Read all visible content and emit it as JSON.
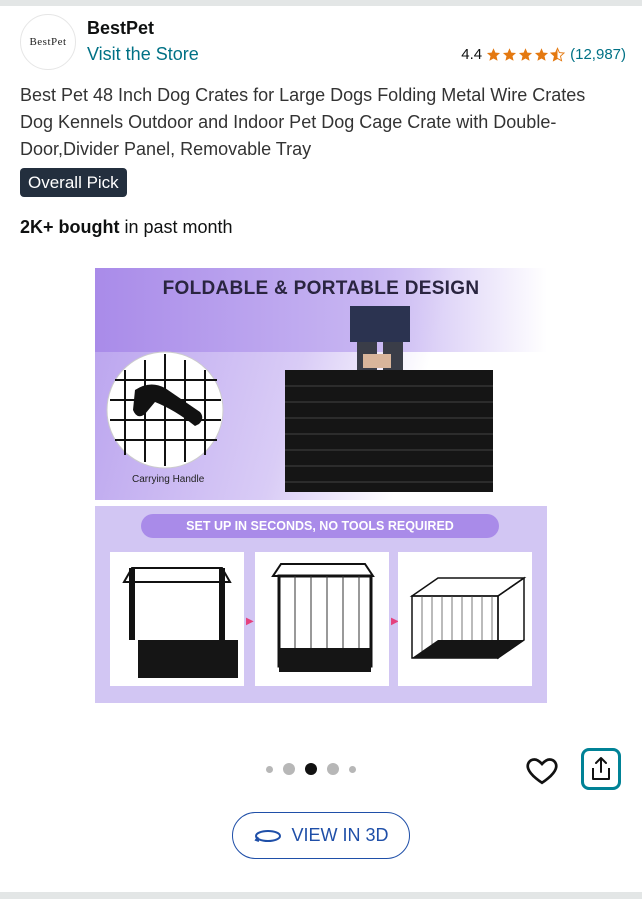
{
  "store": {
    "logo_text": "BestPet",
    "name": "BestPet",
    "visit_label": "Visit the Store"
  },
  "rating": {
    "value": "4.4",
    "stars": 4.5,
    "count": "(12,987)",
    "star_color": "#e47911"
  },
  "product": {
    "title": "Best Pet 48 Inch Dog Crates for Large Dogs Folding Metal Wire Crates Dog Kennels Outdoor and Indoor Pet Dog Cage Crate with Double-Door,Divider Panel, Removable Tray",
    "badge": "Overall Pick",
    "bought_bold": "2K+ bought",
    "bought_rest": " in past month"
  },
  "image": {
    "heading": "FOLDABLE & PORTABLE DESIGN",
    "handle_caption": "Carrying Handle",
    "pill_text": "SET UP IN SECONDS, NO TOOLS REQUIRED"
  },
  "carousel": {
    "total": 5,
    "active_index": 2
  },
  "actions": {
    "heart_icon": "heart-icon",
    "share_icon": "share-icon",
    "view3d_label": "VIEW IN 3D",
    "accent_teal": "#008296",
    "link_blue": "#1f4fa8"
  }
}
